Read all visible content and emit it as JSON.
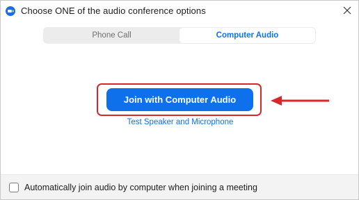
{
  "window": {
    "title": "Choose ONE of the audio conference options",
    "app_icon": "zoom-icon",
    "close_icon": "close-icon"
  },
  "tabs": [
    {
      "label": "Phone Call",
      "active": false
    },
    {
      "label": "Computer Audio",
      "active": true
    }
  ],
  "main": {
    "join_button_label": "Join with Computer Audio",
    "test_link_label": "Test Speaker and Microphone",
    "annotation_arrow_icon": "left-arrow-icon"
  },
  "footer": {
    "checkbox_checked": false,
    "checkbox_label": "Automatically join audio by computer when joining a meeting"
  },
  "colors": {
    "accent": "#0e71eb",
    "annotation": "#d9252c",
    "footer_bg": "#f3f3f3",
    "tab_track": "#ececec"
  }
}
